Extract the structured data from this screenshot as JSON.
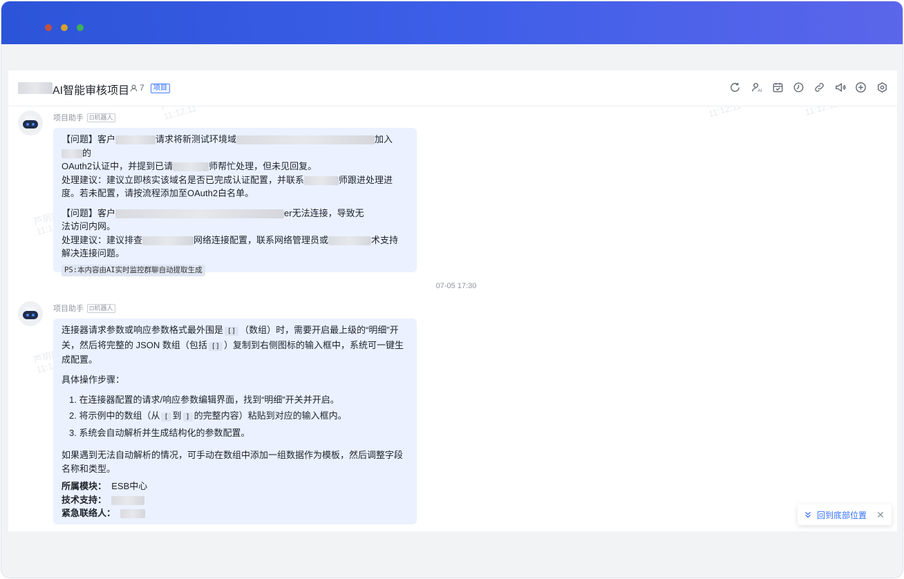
{
  "chat": {
    "title": "AI智能审核项目",
    "member_count": "7",
    "tag": "项目"
  },
  "watermark": {
    "name": "芦玥宸",
    "date": "2026-07-10",
    "time": "11:12:11"
  },
  "toolbar_icons": [
    "refresh-icon",
    "ai-user-icon",
    "calendar-icon",
    "clock-icon",
    "link-icon",
    "announcement-icon",
    "add-icon",
    "settings-icon"
  ],
  "messages": [
    {
      "sender": "项目助手",
      "bot_label": "机器人",
      "issue1": {
        "seg_a": "【问题】客户",
        "seg_b": "请求将新测试环境域",
        "seg_c": "加入",
        "seg_d": "的",
        "seg_e": "OAuth2认证中，并提到已请",
        "seg_f": "师帮忙处理，但未见回复。",
        "suggest_a": "处理建议：建议立即核实该域名是否已完成认证配置，并联系",
        "suggest_b": "师跟进处理进",
        "suggest_c": "度。若未配置，请按流程添加至OAuth2白名单。"
      },
      "issue2": {
        "seg_a": "【问题】客户",
        "seg_b": "er无法连接，导致无",
        "seg_c": "法访问内网。",
        "suggest_a": "处理建议：建议排查",
        "suggest_b": "网络连接配置，联系网络管理员或",
        "suggest_c": "术支持",
        "suggest_d": "解决连接问题。"
      },
      "ps": "PS:本内容由AI实时监控群聊自动提取生成"
    },
    {
      "timestamp": "07-05 17:30",
      "sender": "项目助手",
      "bot_label": "机器人",
      "intro_a": "连接器请求参数或响应参数格式最外围是",
      "code_array": "[]",
      "intro_b": "（数组）时，需要开启最上级的“明细”开",
      "intro_c": "关，然后将完整的 JSON 数组（包括",
      "code_array2": "[]",
      "intro_d": "）复制到右侧图标的输入框中，系统可一键生",
      "intro_e": "成配置。",
      "steps_title": "具体操作步骤：",
      "step1": "在连接器配置的请求/响应参数编辑界面，找到“明细”开关并开启。",
      "step2_a": "将示例中的数组（从",
      "step2_code1": "[",
      "step2_b": "到",
      "step2_code2": "]",
      "step2_c": "的完整内容）粘贴到对应的输入框内。",
      "step3": "系统会自动解析并生成结构化的参数配置。",
      "fallback_a": "如果遇到无法自动解析的情况，可手动在数组中添加一组数据作为模板，然后调整字段",
      "fallback_b": "名称和类型。",
      "module_label": "所属模块：",
      "module_value": "ESB中心",
      "support_label": "技术支持：",
      "contact_label": "紧急联络人："
    }
  ],
  "back_to_bottom": {
    "label": "回到底部位置",
    "close": "✕"
  }
}
